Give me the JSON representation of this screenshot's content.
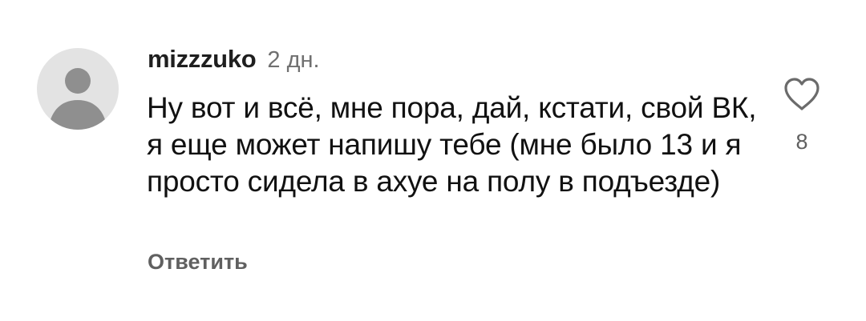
{
  "comment": {
    "username": "mizzzuko",
    "timestamp": "2 дн.",
    "text": "Ну вот и всё, мне пора, дай, кстати, свой ВК, я еще может напишу тебе (мне было 13 и я просто сидела в ахуе на полу в подъезде)",
    "reply_label": "Ответить",
    "likes": "8"
  },
  "icons": {
    "avatar": "default-user-avatar",
    "like": "heart-outline-icon"
  },
  "colors": {
    "avatar_bg": "#e3e3e3",
    "avatar_fg": "#8f8f8f",
    "secondary_text": "#606060"
  }
}
